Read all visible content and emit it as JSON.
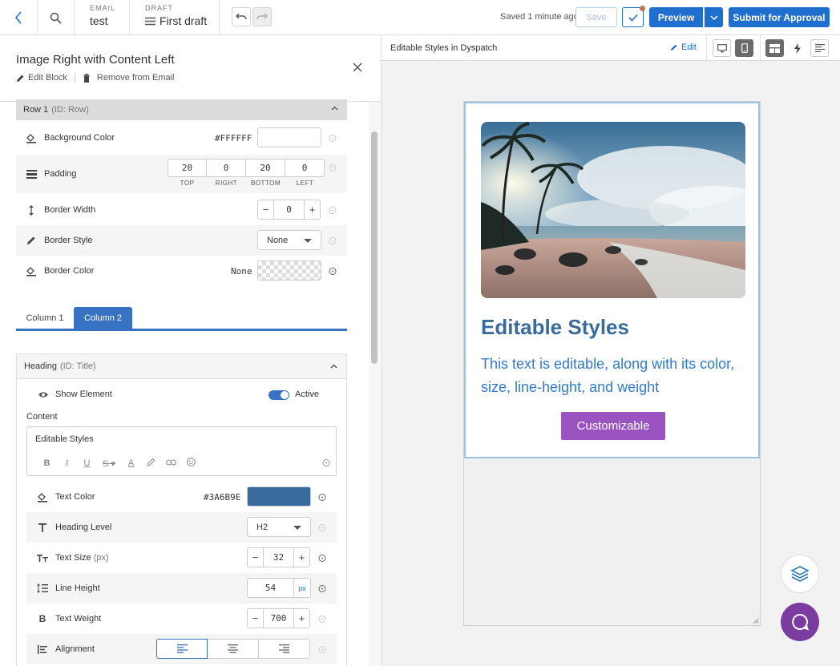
{
  "topbar": {
    "email_label": "EMAIL",
    "email_value": "test",
    "draft_label": "DRAFT",
    "draft_value": "First draft",
    "saved_text": "Saved 1 minute ago",
    "save_label": "Save",
    "preview_label": "Preview",
    "submit_label": "Submit for Approval"
  },
  "panel": {
    "title": "Image Right with Content Left",
    "edit_block": "Edit Block",
    "remove_from_email": "Remove from Email"
  },
  "row": {
    "name": "Row 1",
    "id": "(ID: Row)",
    "background_color_label": "Background Color",
    "background_color_value": "#FFFFFF",
    "padding_label": "Padding",
    "padding": [
      {
        "value": "20",
        "label": "TOP"
      },
      {
        "value": "0",
        "label": "RIGHT"
      },
      {
        "value": "20",
        "label": "BOTTOM"
      },
      {
        "value": "0",
        "label": "LEFT"
      }
    ],
    "border_width_label": "Border Width",
    "border_width_value": "0",
    "border_style_label": "Border Style",
    "border_style_value": "None",
    "border_color_label": "Border Color",
    "border_color_value": "None"
  },
  "column_tabs": [
    "Column 1",
    "Column 2"
  ],
  "heading": {
    "name": "Heading",
    "id": "(ID: Title)",
    "show_element_label": "Show Element",
    "active_label": "Active",
    "content_label": "Content",
    "content_value": "Editable Styles",
    "text_color_label": "Text Color",
    "text_color_value": "#3A6B9E",
    "heading_level_label": "Heading Level",
    "heading_level_value": "H2",
    "text_size_label": "Text Size",
    "text_size_unit": "(px)",
    "text_size_value": "32",
    "line_height_label": "Line Height",
    "line_height_value": "54",
    "line_height_unit": "px",
    "text_weight_label": "Text Weight",
    "text_weight_value": "700",
    "alignment_label": "Alignment"
  },
  "preview": {
    "title": "Editable Styles in Dyspatch",
    "edit_label": "Edit",
    "email_heading": "Editable Styles",
    "email_paragraph": "This text is editable, along with its color, size, line-height, and weight",
    "email_button": "Customizable"
  },
  "colors": {
    "accent": "#1F6FD0",
    "heading_color": "#3A6B9E",
    "cta_button": "#9C53C2",
    "chat_button": "#7B3C9F"
  },
  "icons": [
    "back-arrow-icon",
    "search-icon",
    "menu-icon",
    "undo-icon",
    "redo-icon",
    "check-icon",
    "chevron-down-icon",
    "pencil-icon",
    "trash-icon",
    "close-icon",
    "paint-bucket-icon",
    "padding-icon",
    "vertical-arrows-icon",
    "reset-icon",
    "eye-icon",
    "text-icon",
    "bold-icon",
    "align-left-icon",
    "align-center-icon",
    "align-right-icon",
    "desktop-icon",
    "mobile-icon",
    "layout-icon",
    "bolt-icon",
    "list-icon",
    "layers-icon",
    "chat-icon"
  ]
}
